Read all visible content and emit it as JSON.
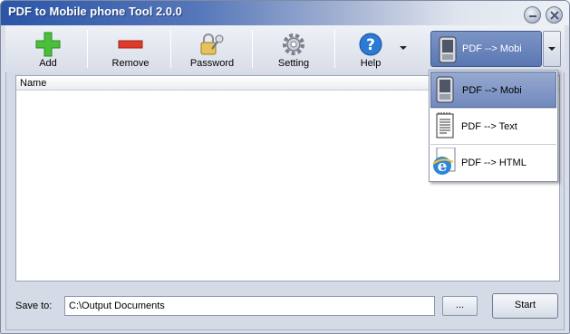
{
  "window": {
    "title": "PDF to Mobile phone  Tool 2.0.0"
  },
  "toolbar": {
    "add_label": "Add",
    "remove_label": "Remove",
    "password_label": "Password",
    "setting_label": "Setting",
    "help_label": "Help"
  },
  "converter": {
    "selected": "PDF --> Mobi",
    "options": [
      {
        "label": "PDF --> Mobi",
        "icon": "phone-icon",
        "selected": true
      },
      {
        "label": "PDF --> Text",
        "icon": "text-document-icon",
        "selected": false
      },
      {
        "label": "PDF --> HTML",
        "icon": "ie-browser-icon",
        "selected": false
      }
    ]
  },
  "file_list": {
    "columns": [
      "Name"
    ]
  },
  "footer": {
    "save_to_label": "Save to:",
    "save_to_value": "C:\\Output Documents",
    "browse_label": "...",
    "start_label": "Start"
  },
  "colors": {
    "accent": "#5a77b2",
    "titlebar": "#2b55a8"
  }
}
